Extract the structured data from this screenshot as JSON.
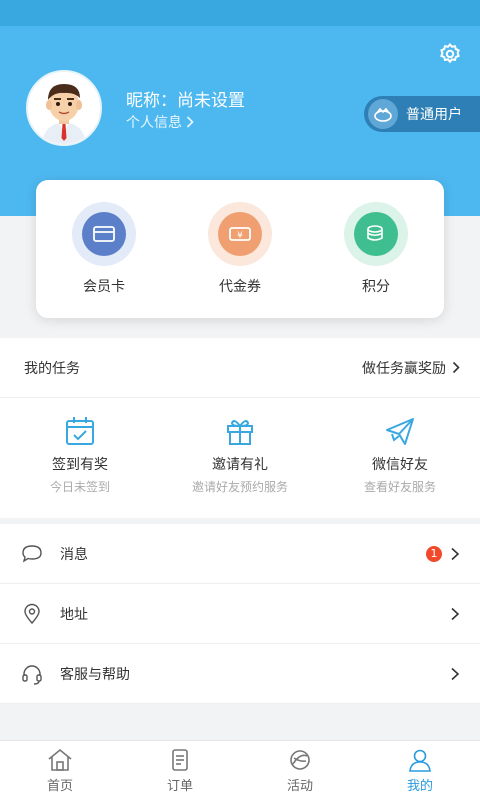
{
  "colors": {
    "primary": "#4db8ef",
    "status_bar": "#3aa8e0",
    "badge_bg": "#2e7fb5",
    "notice_red": "#f04a2a",
    "active_tab": "#2a9be0"
  },
  "header": {
    "settings_icon": "gear-icon",
    "nickname": "昵称：尚未设置",
    "profile_link": "个人信息",
    "user_level": "普通用户"
  },
  "card": {
    "items": [
      {
        "label": "会员卡",
        "icon": "membership-card-icon",
        "color": "#5b7fc9"
      },
      {
        "label": "代金券",
        "icon": "voucher-icon",
        "color": "#f0a070"
      },
      {
        "label": "积分",
        "icon": "points-icon",
        "color": "#3fbf8f"
      }
    ]
  },
  "tasks": {
    "title": "我的任务",
    "link": "做任务赢奖励",
    "items": [
      {
        "title": "签到有奖",
        "subtitle": "今日未签到",
        "icon": "calendar-check-icon"
      },
      {
        "title": "邀请有礼",
        "subtitle": "邀请好友预约服务",
        "icon": "gift-icon"
      },
      {
        "title": "微信好友",
        "subtitle": "查看好友服务",
        "icon": "paper-plane-icon"
      }
    ]
  },
  "menu": {
    "items": [
      {
        "label": "消息",
        "icon": "chat-bubble-icon",
        "badge": "1"
      },
      {
        "label": "地址",
        "icon": "location-pin-icon"
      },
      {
        "label": "客服与帮助",
        "icon": "headset-icon"
      }
    ]
  },
  "tabbar": {
    "items": [
      {
        "label": "首页",
        "icon": "home-icon"
      },
      {
        "label": "订单",
        "icon": "order-icon"
      },
      {
        "label": "活动",
        "icon": "activity-icon"
      },
      {
        "label": "我的",
        "icon": "user-icon",
        "active": true
      }
    ]
  }
}
